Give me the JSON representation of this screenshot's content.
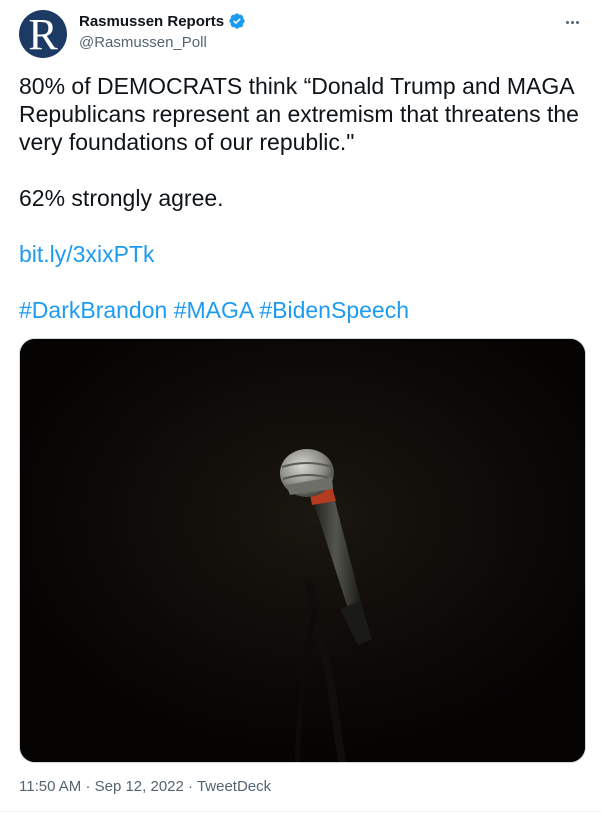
{
  "author": {
    "avatar_letter": "R",
    "display_name": "Rasmussen Reports",
    "handle": "@Rasmussen_Poll",
    "verified": true,
    "avatar_color": "#1c3a63"
  },
  "tweet": {
    "line1": "80% of DEMOCRATS think “Donald Trump and MAGA Republicans represent an extremism that threatens the very foundations of our republic.\"",
    "line2": "62% strongly agree.",
    "link": "bit.ly/3xixPTk",
    "hashtags": [
      "#DarkBrandon",
      "#MAGA",
      "#BidenSpeech"
    ]
  },
  "media": {
    "description_icon": "microphone-image"
  },
  "meta": {
    "time": "11:50 AM",
    "separator": "·",
    "date": "Sep 12, 2022",
    "source": "TweetDeck"
  },
  "colors": {
    "link": "#1d9bf0",
    "text": "#0f1419",
    "secondary": "#536471"
  },
  "icons": {
    "verified": "verified-badge-icon",
    "more": "more-options-icon"
  }
}
